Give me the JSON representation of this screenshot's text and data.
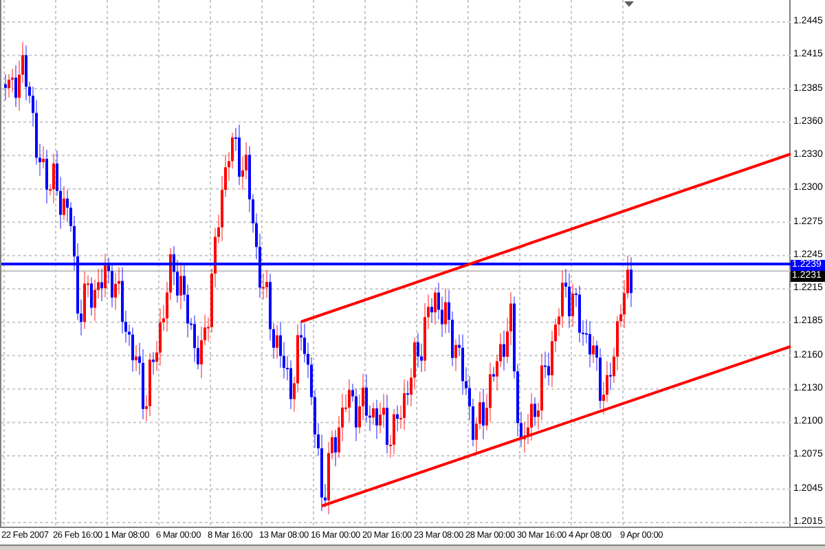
{
  "price_axis": {
    "labels": [
      "1.2445",
      "1.2415",
      "1.2385",
      "1.2360",
      "1.2330",
      "1.2300",
      "1.2275",
      "1.2245",
      "1.2215",
      "1.2185",
      "1.2160",
      "1.2130",
      "1.2100",
      "1.2075",
      "1.2045",
      "1.2015"
    ]
  },
  "price_markers": [
    {
      "value": "1.2239",
      "kind": "line"
    },
    {
      "value": "1.2231",
      "kind": "bid"
    }
  ],
  "time_axis": {
    "labels": [
      "22 Feb 2007",
      "26 Feb 16:00",
      "1 Mar 08:00",
      "6 Mar 00:00",
      "8 Mar 16:00",
      "13 Mar 08:00",
      "16 Mar 00:00",
      "20 Mar 16:00",
      "23 Mar 08:00",
      "28 Mar 00:00",
      "30 Mar 16:00",
      "4 Apr 08:00",
      "9 Apr 00:00"
    ]
  }
}
